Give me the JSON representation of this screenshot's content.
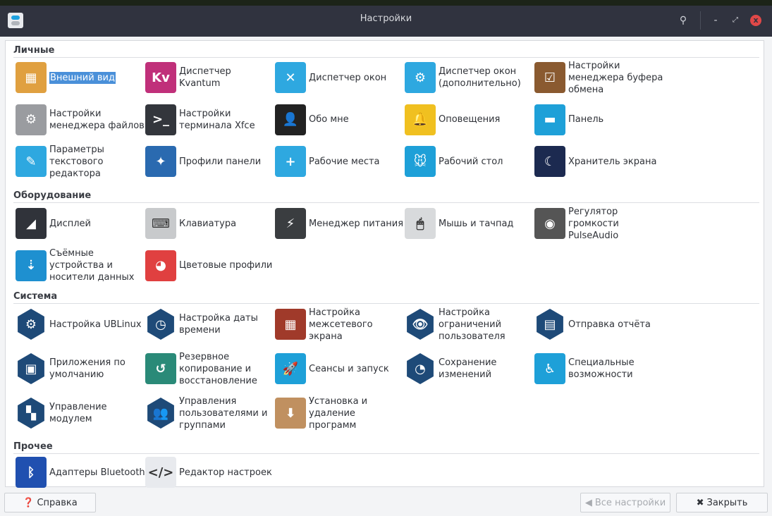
{
  "window": {
    "title": "Настройки"
  },
  "sections": [
    {
      "title": "Личные",
      "items": [
        {
          "label": "Внешний вид",
          "icon": "appearance-icon",
          "color": "#e0a040",
          "glyph": "▦",
          "selected": true
        },
        {
          "label": "Диспетчер Kvantum",
          "icon": "kvantum-icon",
          "color": "#c0307a",
          "glyph": "Kv"
        },
        {
          "label": "Диспетчер окон",
          "icon": "window-manager-icon",
          "color": "#2ea8e0",
          "glyph": "✕"
        },
        {
          "label": "Диспетчер окон (дополнительно)",
          "icon": "window-manager-tweaks-icon",
          "color": "#2ea8e0",
          "glyph": "⚙"
        },
        {
          "label": "Настройки менеджера буфера обмена",
          "icon": "clipboard-icon",
          "color": "#8a5a30",
          "glyph": "☑"
        },
        {
          "label": "Настройки менеджера файлов",
          "icon": "file-manager-icon",
          "color": "#9a9ca0",
          "glyph": "⚙"
        },
        {
          "label": "Настройки терминала Xfce",
          "icon": "terminal-icon",
          "color": "#33363c",
          "glyph": ">_"
        },
        {
          "label": "Обо мне",
          "icon": "about-me-icon",
          "color": "#222",
          "glyph": "👤"
        },
        {
          "label": "Оповещения",
          "icon": "notifications-bell-icon",
          "color": "#f0c020",
          "glyph": "🔔"
        },
        {
          "label": "Панель",
          "icon": "panel-icon",
          "color": "#1ea0d8",
          "glyph": "▬"
        },
        {
          "label": "Параметры текстового редактора",
          "icon": "text-editor-icon",
          "color": "#2ea8e0",
          "glyph": "✎"
        },
        {
          "label": "Профили панели",
          "icon": "panel-profiles-icon",
          "color": "#2a6ab0",
          "glyph": "✦"
        },
        {
          "label": "Рабочие места",
          "icon": "workspaces-icon",
          "color": "#2ea8e0",
          "glyph": "+"
        },
        {
          "label": "Рабочий стол",
          "icon": "desktop-icon",
          "color": "#1ea0d8",
          "glyph": "🐭"
        },
        {
          "label": "Хранитель экрана",
          "icon": "screensaver-icon",
          "color": "#1c2a50",
          "glyph": "☾"
        }
      ]
    },
    {
      "title": "Оборудование",
      "items": [
        {
          "label": "Дисплей",
          "icon": "display-icon",
          "color": "#30333a",
          "glyph": "◢"
        },
        {
          "label": "Клавиатура",
          "icon": "keyboard-icon",
          "color": "#c8cacc",
          "glyph": "⌨"
        },
        {
          "label": "Менеджер питания",
          "icon": "battery-icon",
          "color": "#3a3d40",
          "glyph": "⚡"
        },
        {
          "label": "Мышь и тачпад",
          "icon": "mouse-icon",
          "color": "#d8dadc",
          "glyph": "🖱"
        },
        {
          "label": "Регулятор громкости PulseAudio",
          "icon": "speaker-icon",
          "color": "#555",
          "glyph": "◉"
        },
        {
          "label": "Съёмные устройства и носители данных",
          "icon": "usb-drive-icon",
          "color": "#1e90d0",
          "glyph": "⇣"
        },
        {
          "label": "Цветовые профили",
          "icon": "color-profiles-icon",
          "color": "#e04040",
          "glyph": "◕"
        }
      ]
    },
    {
      "title": "Система",
      "items": [
        {
          "label": "Настройка UBLinux",
          "icon": "ublinux-settings-icon",
          "color": "#1e4a78",
          "glyph": "⚙",
          "hex": true
        },
        {
          "label": "Настройка даты времени",
          "icon": "date-time-icon",
          "color": "#1e4a78",
          "glyph": "◷",
          "hex": true
        },
        {
          "label": "Настройка межсетевого экрана",
          "icon": "firewall-icon",
          "color": "#a03a2a",
          "glyph": "▦"
        },
        {
          "label": "Настройка ограничений пользователя",
          "icon": "user-restrictions-icon",
          "color": "#1e4a78",
          "glyph": "👁",
          "hex": true
        },
        {
          "label": "Отправка отчёта",
          "icon": "send-report-icon",
          "color": "#1e4a78",
          "glyph": "▤",
          "hex": true
        },
        {
          "label": "Приложения по умолчанию",
          "icon": "default-apps-icon",
          "color": "#1e4a78",
          "glyph": "▣",
          "hex": true
        },
        {
          "label": "Резервное копирование и восстановление",
          "icon": "backup-icon",
          "color": "#2a8a78",
          "glyph": "↺"
        },
        {
          "label": "Сеансы и запуск",
          "icon": "sessions-rocket-icon",
          "color": "#1ea0d8",
          "glyph": "🚀"
        },
        {
          "label": "Сохранение изменений",
          "icon": "save-changes-icon",
          "color": "#1e4a78",
          "glyph": "◔",
          "hex": true
        },
        {
          "label": "Специальные возможности",
          "icon": "accessibility-icon",
          "color": "#1ea0d8",
          "glyph": "♿"
        },
        {
          "label": "Управление модулем",
          "icon": "modules-icon",
          "color": "#1e4a78",
          "glyph": "▚",
          "hex": true
        },
        {
          "label": "Управления пользователями и группами",
          "icon": "users-groups-icon",
          "color": "#1e4a78",
          "glyph": "👥",
          "hex": true
        },
        {
          "label": "Установка и удаление программ",
          "icon": "package-install-icon",
          "color": "#c09060",
          "glyph": "⬇"
        }
      ]
    },
    {
      "title": "Прочее",
      "items": [
        {
          "label": "Адаптеры Bluetooth",
          "icon": "bluetooth-icon",
          "color": "#2050b0",
          "glyph": "ᛒ"
        },
        {
          "label": "Редактор настроек",
          "icon": "settings-editor-icon",
          "color": "#e8eaee",
          "glyph": "</>"
        }
      ]
    }
  ],
  "footer": {
    "help": "Справка",
    "all_settings": "Все настройки",
    "close": "Закрыть"
  }
}
